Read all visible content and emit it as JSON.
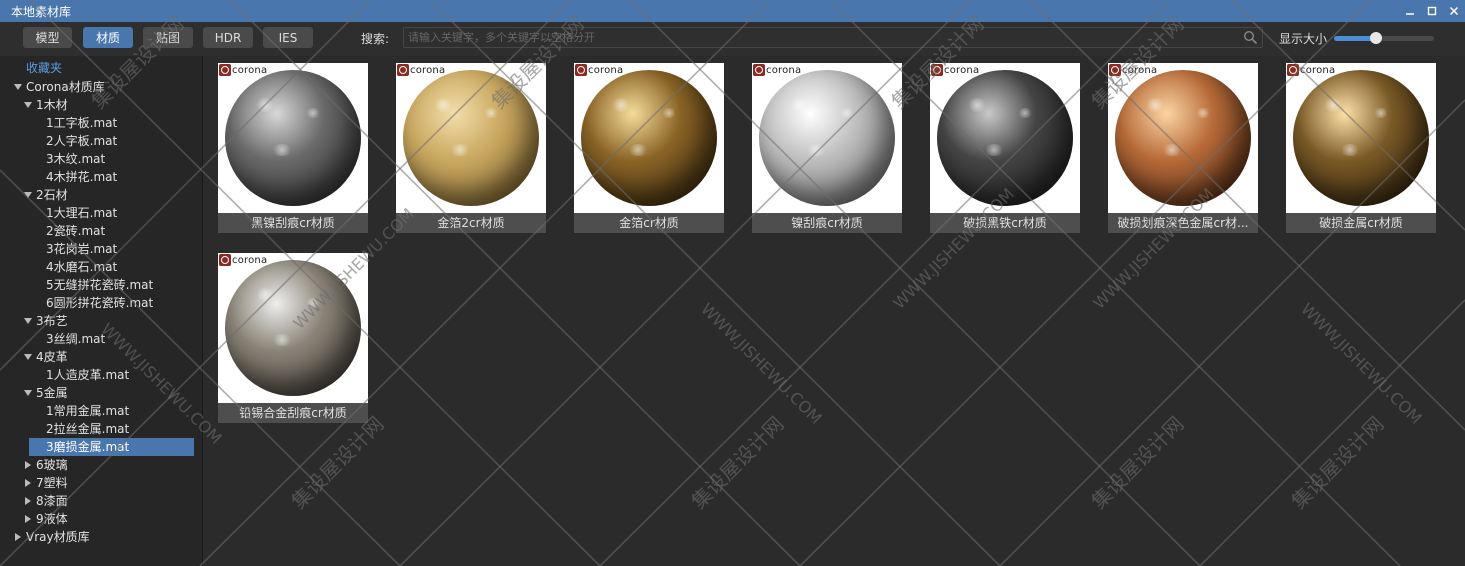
{
  "window": {
    "title": "本地素材库",
    "controls": [
      "minimize-icon",
      "maximize-icon",
      "close-icon"
    ]
  },
  "toolbar": {
    "tabs": [
      {
        "label": "模型",
        "active": false
      },
      {
        "label": "材质",
        "active": true
      },
      {
        "label": "贴图",
        "active": false
      },
      {
        "label": "HDR",
        "active": false
      },
      {
        "label": "IES",
        "active": false
      }
    ],
    "search_label": "搜索:",
    "search_placeholder": "请输入关键字，多个关键字以空格分开",
    "search_value": "",
    "display_size_label": "显示大小",
    "display_size_value": 0.42
  },
  "sidebar": {
    "favorites_label": "收藏夹",
    "tree": [
      {
        "label": "Corona材质库",
        "level": 0,
        "expanded": true
      },
      {
        "label": "1木材",
        "level": 1,
        "expanded": true
      },
      {
        "label": "1工字板.mat",
        "level": 2
      },
      {
        "label": "2人字板.mat",
        "level": 2
      },
      {
        "label": "3木纹.mat",
        "level": 2
      },
      {
        "label": "4木拼花.mat",
        "level": 2
      },
      {
        "label": "2石材",
        "level": 1,
        "expanded": true
      },
      {
        "label": "1大理石.mat",
        "level": 2
      },
      {
        "label": "2瓷砖.mat",
        "level": 2
      },
      {
        "label": "3花岗岩.mat",
        "level": 2
      },
      {
        "label": "4水磨石.mat",
        "level": 2
      },
      {
        "label": "5无缝拼花瓷砖.mat",
        "level": 2
      },
      {
        "label": "6圆形拼花瓷砖.mat",
        "level": 2
      },
      {
        "label": "3布艺",
        "level": 1,
        "expanded": true
      },
      {
        "label": "3丝绸.mat",
        "level": 2
      },
      {
        "label": "4皮革",
        "level": 1,
        "expanded": true
      },
      {
        "label": "1人造皮革.mat",
        "level": 2
      },
      {
        "label": "5金属",
        "level": 1,
        "expanded": true
      },
      {
        "label": "1常用金属.mat",
        "level": 2
      },
      {
        "label": "2拉丝金属.mat",
        "level": 2
      },
      {
        "label": "3磨损金属.mat",
        "level": 2,
        "selected": true
      },
      {
        "label": "6玻璃",
        "level": 1,
        "expanded": false
      },
      {
        "label": "7塑料",
        "level": 1,
        "expanded": false
      },
      {
        "label": "8漆面",
        "level": 1,
        "expanded": false
      },
      {
        "label": "9液体",
        "level": 1,
        "expanded": false
      },
      {
        "label": "Vray材质库",
        "level": 0,
        "expanded": false
      }
    ]
  },
  "materials": [
    {
      "name": "黑镍刮痕cr材质",
      "logo": "corona",
      "colors": [
        "#d8d8d8",
        "#6a6a6a",
        "#1e1e1e"
      ]
    },
    {
      "name": "金箔2cr材质",
      "logo": "corona",
      "colors": [
        "#f2deaa",
        "#c9a860",
        "#6e5526"
      ]
    },
    {
      "name": "金箔cr材质",
      "logo": "corona",
      "colors": [
        "#f5dc9a",
        "#8a6426",
        "#2a1d0a"
      ]
    },
    {
      "name": "镍刮痕cr材质",
      "logo": "corona",
      "colors": [
        "#ffffff",
        "#bdbdbd",
        "#5e5e5e"
      ]
    },
    {
      "name": "破损黑铁cr材质",
      "logo": "corona",
      "colors": [
        "#c9c9c9",
        "#454545",
        "#141414"
      ]
    },
    {
      "name": "破损划痕深色金属cr材...",
      "logo": "corona",
      "colors": [
        "#fbd4a4",
        "#b66a38",
        "#3a1d0c"
      ]
    },
    {
      "name": "破损金属cr材质",
      "logo": "corona",
      "colors": [
        "#fde0a8",
        "#7a5a26",
        "#201608"
      ]
    },
    {
      "name": "铅锡合金刮痕cr材质",
      "logo": "corona",
      "colors": [
        "#eeeeee",
        "#8a8478",
        "#2e2a25"
      ]
    }
  ],
  "watermark": {
    "text_cn": "集设屋设计网",
    "text_en": "WWW.JISHEWU.COM",
    "color": "#6d6d6d"
  }
}
